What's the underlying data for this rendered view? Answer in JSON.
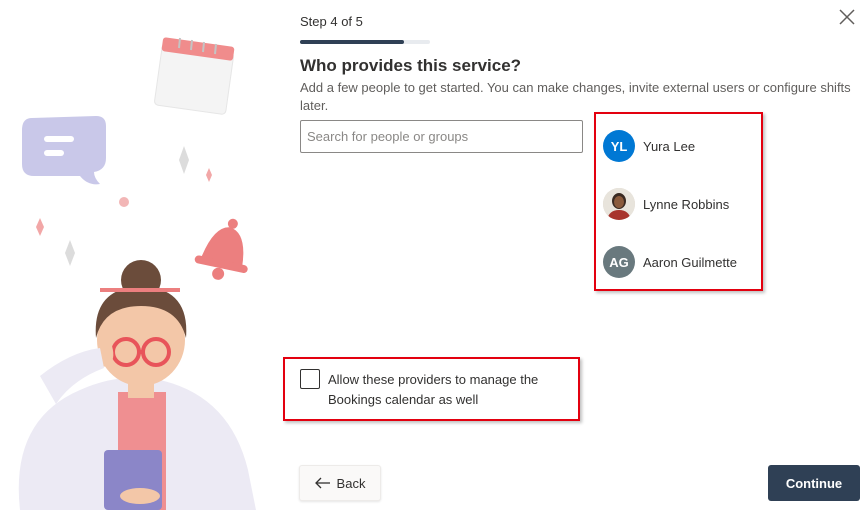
{
  "wizard": {
    "step_label": "Step 4 of 5",
    "progress": 0.8,
    "title": "Who provides this service?",
    "subtitle": "Add a few people to get started. You can make changes, invite external users or configure shifts later."
  },
  "search": {
    "placeholder": "Search for people or groups",
    "value": ""
  },
  "people": [
    {
      "initials": "YL",
      "name": "Yura Lee",
      "color": "#0078d4"
    },
    {
      "initials": "",
      "name": "Lynne Robbins",
      "avatar": "photo"
    },
    {
      "initials": "AG",
      "name": "Aaron Guilmette",
      "color": "#69797e"
    }
  ],
  "option": {
    "label": "Allow these providers to manage the Bookings calendar as well",
    "checked": false
  },
  "footer": {
    "back_label": "Back",
    "continue_label": "Continue"
  },
  "colors": {
    "primary": "#2f4055",
    "annotation": "#e3000f"
  }
}
